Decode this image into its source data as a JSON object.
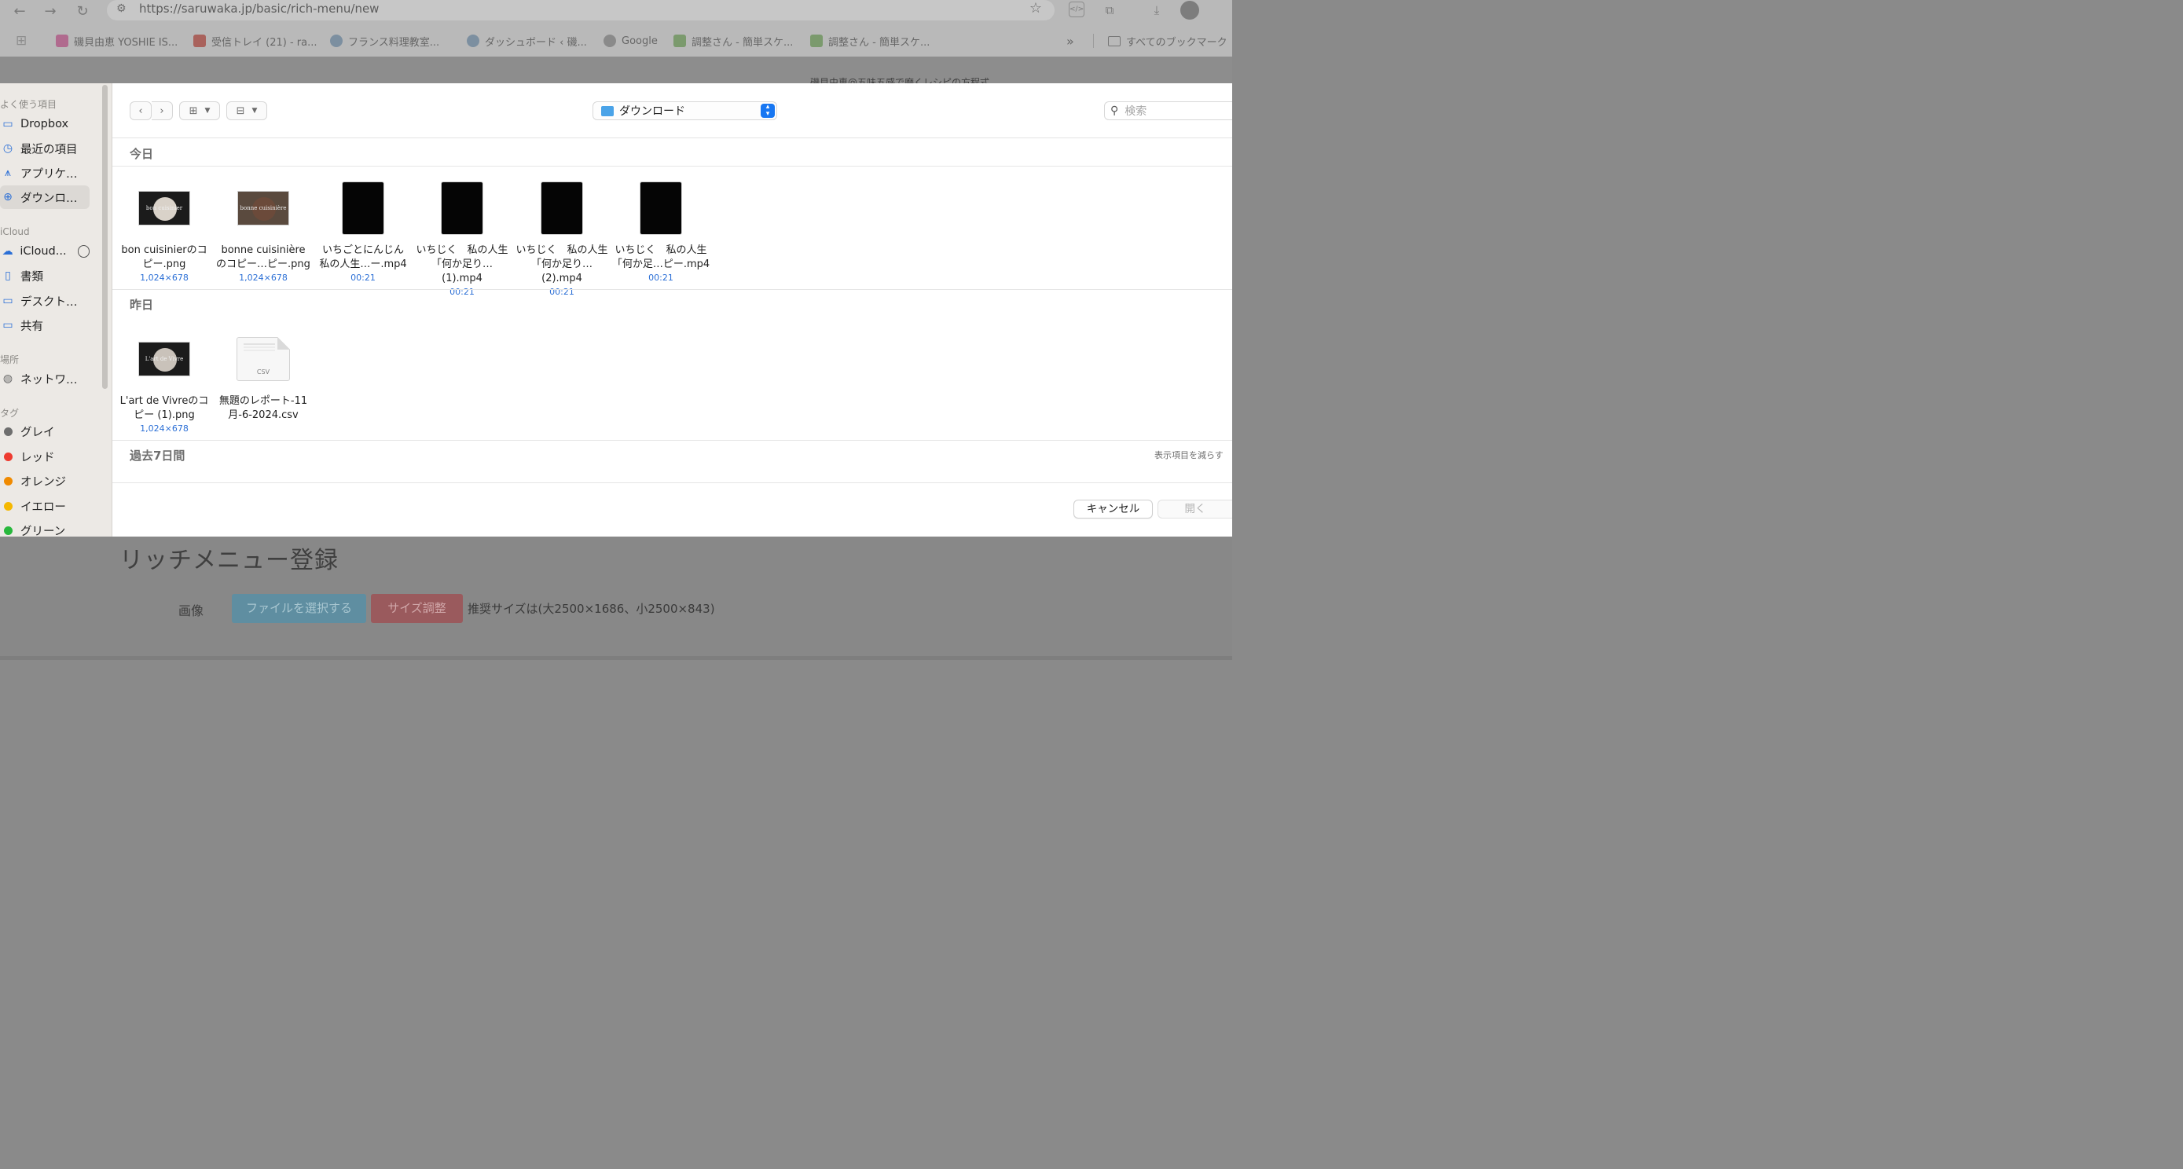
{
  "browser": {
    "url": "https://saruwaka.jp/basic/rich-menu/new",
    "bookmarks": [
      {
        "label": "磯貝由恵 YOSHIE IS...",
        "color": "#b06a8e"
      },
      {
        "label": "受信トレイ (21) - ra...",
        "color": "#a9625c"
      },
      {
        "label": "フランス料理教室...",
        "color": "#7c8fa0"
      },
      {
        "label": "ダッシュボード ‹ 磯...",
        "color": "#7c8fa0"
      },
      {
        "label": "Google",
        "color": "#8a8a8a"
      },
      {
        "label": "調整さん - 簡単スケ...",
        "color": "#7b9a6d"
      },
      {
        "label": "調整さん - 簡単スケ...",
        "color": "#7b9a6d"
      }
    ],
    "overflow_label": "»",
    "all_bookmarks": "すべてのブックマーク",
    "page_behind_subtitle": "磯貝由恵@五味五感で磨くレシピの方程式"
  },
  "page": {
    "title": "リッチメニュー登録",
    "image_label": "画像",
    "choose_file_button": "ファイルを選択する",
    "resize_button": "サイズ調整",
    "size_hint": "推奨サイズは(大2500×1686、小2500×843)"
  },
  "sidebar": {
    "favorites_header": "よく使う項目",
    "favorites": [
      {
        "label": "Dropbox",
        "icon": "folder-icon"
      },
      {
        "label": "最近の項目",
        "icon": "clock-icon"
      },
      {
        "label": "アプリケ…",
        "icon": "applications-icon"
      },
      {
        "label": "ダウンロ…",
        "icon": "download-icon",
        "selected": true
      }
    ],
    "icloud_header": "iCloud",
    "icloud": [
      {
        "label": "iCloud...",
        "icon": "cloud-icon"
      },
      {
        "label": "書類",
        "icon": "document-icon"
      },
      {
        "label": "デスクト…",
        "icon": "desktop-icon"
      },
      {
        "label": "共有",
        "icon": "shared-folder-icon"
      }
    ],
    "locations_header": "場所",
    "locations": [
      {
        "label": "ネットワ…",
        "icon": "network-icon"
      }
    ],
    "tags_header": "タグ",
    "tags": [
      {
        "label": "グレイ",
        "color": "#8e8e93"
      },
      {
        "label": "レッド",
        "color": "#ff3b30"
      },
      {
        "label": "オレンジ",
        "color": "#ff9500"
      },
      {
        "label": "イエロー",
        "color": "#ffcc00"
      },
      {
        "label": "グリーン",
        "color": "#28cd41"
      }
    ]
  },
  "toolbar": {
    "location": "ダウンロード",
    "search_placeholder": "検索"
  },
  "groups": {
    "today": {
      "header": "今日",
      "files": [
        {
          "name_line1": "bon cuisinierのコ",
          "name_line2": "ピー.png",
          "meta": "1,024×678",
          "thumb_title": "bon cuisinier"
        },
        {
          "name_line1": "bonne cuisinière",
          "name_line2": "のコピー…ピー.png",
          "meta": "1,024×678",
          "thumb_title": "bonne cuisinière"
        },
        {
          "name_line1": "いちごとにんじん",
          "name_line2": "私の人生…ー.mp4",
          "meta": "00:21"
        },
        {
          "name_line1": "いちじく　私の人生",
          "name_line2": "「何か足り…(1).mp4",
          "meta": "00:21"
        },
        {
          "name_line1": "いちじく　私の人生",
          "name_line2": "「何か足り…(2).mp4",
          "meta": "00:21"
        },
        {
          "name_line1": "いちじく　私の人生",
          "name_line2": "「何か足…ピー.mp4",
          "meta": "00:21"
        }
      ]
    },
    "yesterday": {
      "header": "昨日",
      "files": [
        {
          "name_line1": "L'art de Vivreのコ",
          "name_line2": "ピー (1).png",
          "meta": "1,024×678",
          "thumb_title": "L'art de Vivre"
        },
        {
          "name_line1": "無題のレポート-11",
          "name_line2": "月-6-2024.csv",
          "meta": "",
          "doc_ext": "CSV"
        }
      ]
    },
    "past7": {
      "header": "過去7日間",
      "show_less": "表示項目を減らす"
    }
  },
  "buttons": {
    "cancel": "キャンセル",
    "open": "開く"
  },
  "colors": {
    "accent": "#1877f2",
    "meta_blue": "#2b6fd6",
    "choose_file_bg": "#5f8ea1",
    "resize_bg": "#9a5a5d"
  }
}
